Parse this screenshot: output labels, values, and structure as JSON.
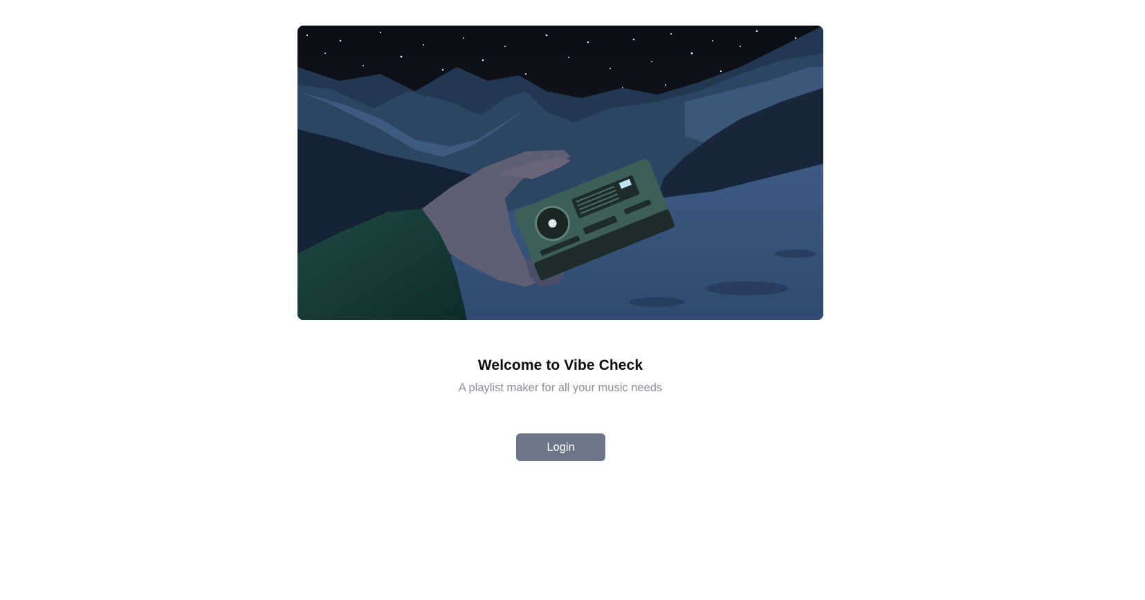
{
  "hero": {
    "image_name": "night-mountain-radio-illustration"
  },
  "welcome": {
    "title": "Welcome to Vibe Check",
    "subtitle": "A playlist maker for all your music needs"
  },
  "auth": {
    "login_label": "Login"
  },
  "colors": {
    "button": "#6b7789",
    "subtitle": "#8b8f99",
    "title": "#0b0b0f",
    "sky": "#0f1119",
    "mountain": "#2c4563",
    "snow": "#3a5478"
  }
}
